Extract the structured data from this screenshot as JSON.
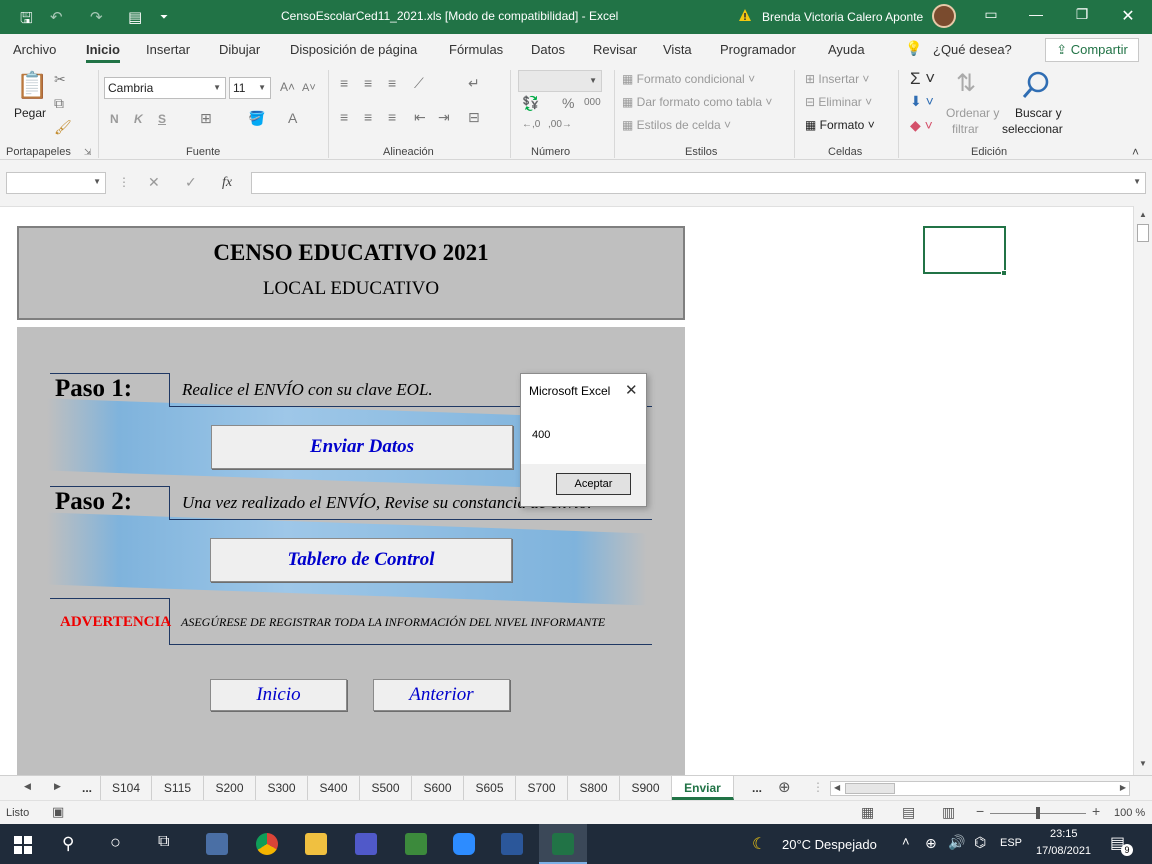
{
  "titlebar": {
    "title": "CensoEscolarCed11_2021.xls  [Modo de compatibilidad]  -  Excel",
    "user": "Brenda Victoria Calero Aponte"
  },
  "ribbon_tabs": [
    "Archivo",
    "Inicio",
    "Insertar",
    "Dibujar",
    "Disposición de página",
    "Fórmulas",
    "Datos",
    "Revisar",
    "Vista",
    "Programador",
    "Ayuda"
  ],
  "tell_me": "¿Qué desea?",
  "share_label": "Compartir",
  "ribbon": {
    "paste": "Pegar",
    "font_name": "Cambria",
    "font_size": "11",
    "bold": "N",
    "italic": "K",
    "underline": "S",
    "cond_format": "Formato condicional",
    "format_table": "Dar formato como tabla",
    "cell_styles": "Estilos de celda",
    "insert": "Insertar",
    "delete": "Eliminar",
    "format": "Formato",
    "sort_filter_1": "Ordenar y",
    "sort_filter_2": "filtrar",
    "find_select_1": "Buscar y",
    "find_select_2": "seleccionar",
    "groups": {
      "clipboard": "Portapapeles",
      "font": "Fuente",
      "alignment": "Alineación",
      "number": "Número",
      "styles": "Estilos",
      "cells": "Celdas",
      "editing": "Edición"
    }
  },
  "formula_bar": {
    "fx": "fx",
    "value": ""
  },
  "sheet": {
    "title": "CENSO EDUCATIVO 2021",
    "subtitle": "LOCAL EDUCATIVO",
    "step1_label": "Paso 1:",
    "step1_text": "Realice el ENVÍO con su clave EOL.",
    "send_button": "Enviar Datos",
    "step2_label": "Paso 2:",
    "step2_text": "Una vez realizado el ENVÍO,  Revise su constancia de envío.",
    "dashboard_button": "Tablero de Control",
    "warning_label": "ADVERTENCIA",
    "warning_text": "ASEGÚRESE DE REGISTRAR TODA LA INFORMACIÓN DEL NIVEL INFORMANTE",
    "home_button": "Inicio",
    "back_button": "Anterior"
  },
  "dialog": {
    "title": "Microsoft Excel",
    "message": "400",
    "ok": "Aceptar"
  },
  "sheet_tabs": [
    "...",
    "S104",
    "S115",
    "S200",
    "S300",
    "S400",
    "S500",
    "S600",
    "S605",
    "S700",
    "S800",
    "S900",
    "Enviar",
    "..."
  ],
  "active_sheet": "Enviar",
  "status": {
    "ready": "Listo",
    "zoom": "100 %"
  },
  "taskbar": {
    "weather": "20°C  Despejado",
    "lang": "ESP",
    "time": "23:15",
    "date": "17/08/2021",
    "notifications": "9"
  }
}
